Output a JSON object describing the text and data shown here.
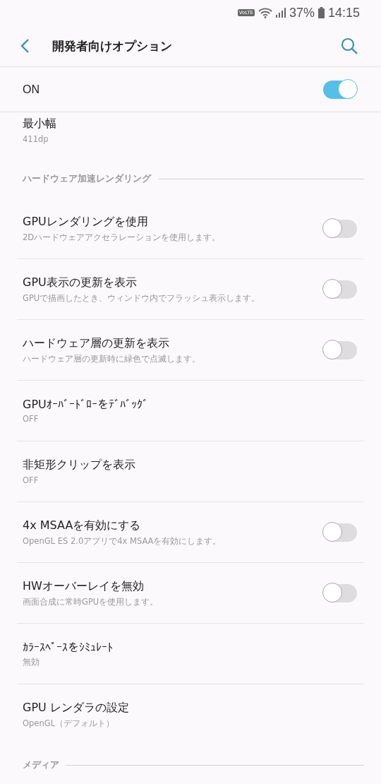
{
  "status_bar": {
    "volte": "VoLTE",
    "battery_text": "37%",
    "time": "14:15"
  },
  "header": {
    "title": "開発者向けオプション"
  },
  "master_switch": {
    "label": "ON",
    "on": true
  },
  "top_item": {
    "title": "最小幅",
    "summary": "411dp"
  },
  "sections": [
    {
      "title": "ハードウェア加速レンダリング",
      "items": [
        {
          "kind": "toggle",
          "title": "GPUレンダリングを使用",
          "summary": "2Dハードウェアアクセラレーションを使用します。",
          "on": false
        },
        {
          "kind": "toggle",
          "title": "GPU表示の更新を表示",
          "summary": "GPUで描画したとき、ウィンドウ内でフラッシュ表示します。",
          "on": false
        },
        {
          "kind": "toggle",
          "title": "ハードウェア層の更新を表示",
          "summary": "ハードウェア層の更新時に緑色で点滅します。",
          "on": false
        },
        {
          "kind": "value",
          "title": "GPUｵｰﾊﾞｰﾄﾞﾛｰをﾃﾞﾊﾞｯｸﾞ",
          "summary": "OFF"
        },
        {
          "kind": "value",
          "title": "非矩形クリップを表示",
          "summary": "OFF"
        },
        {
          "kind": "toggle",
          "title": "4x MSAAを有効にする",
          "summary": "OpenGL ES 2.0アプリで4x MSAAを有効にします。",
          "on": false
        },
        {
          "kind": "toggle",
          "title": "HWオーバーレイを無効",
          "summary": "画面合成に常時GPUを使用します。",
          "on": false
        },
        {
          "kind": "value",
          "title": "ｶﾗｰｽﾍﾟｰｽをｼﾐｭﾚｰﾄ",
          "summary": "無効"
        },
        {
          "kind": "value",
          "title": "GPU レンダラの設定",
          "summary": "OpenGL（デフォルト）"
        }
      ]
    },
    {
      "title": "メディア"
    }
  ]
}
